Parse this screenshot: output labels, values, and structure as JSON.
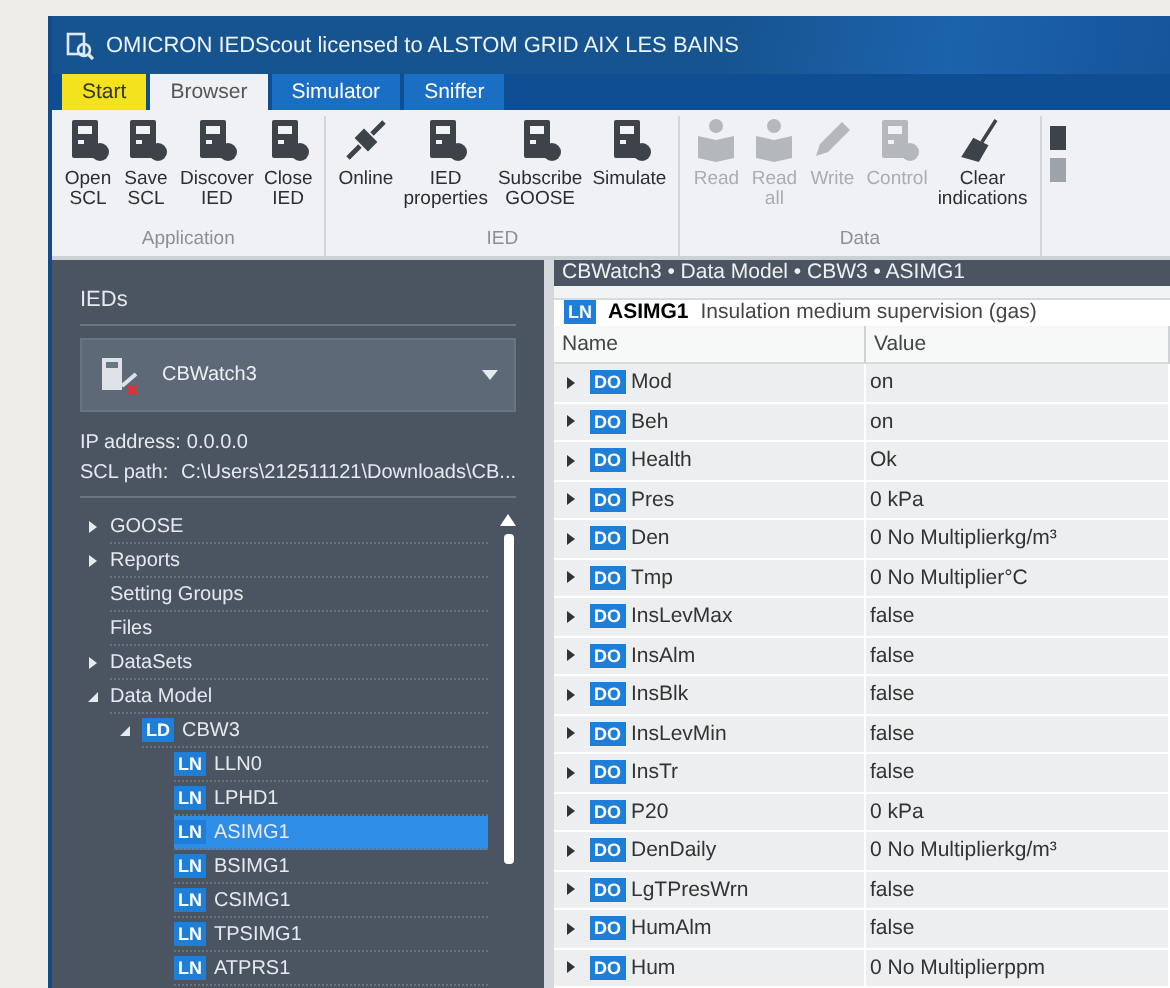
{
  "window": {
    "title": "OMICRON IEDScout licensed to ALSTOM GRID AIX LES BAINS"
  },
  "tabs": [
    {
      "label": "Start",
      "kind": "start",
      "selected": false
    },
    {
      "label": "Browser",
      "kind": "tab",
      "selected": true
    },
    {
      "label": "Simulator",
      "kind": "tab",
      "selected": false
    },
    {
      "label": "Sniffer",
      "kind": "tab",
      "selected": false
    }
  ],
  "ribbon_groups": [
    {
      "label": "Application",
      "buttons": [
        {
          "label": "Open\nSCL",
          "disabled": false
        },
        {
          "label": "Save\nSCL",
          "disabled": false
        },
        {
          "label": "Discover\nIED",
          "disabled": false
        },
        {
          "label": "Close\nIED",
          "disabled": false
        }
      ]
    },
    {
      "label": "IED",
      "buttons": [
        {
          "label": "Online",
          "disabled": false
        },
        {
          "label": "IED\nproperties",
          "disabled": false
        },
        {
          "label": "Subscribe\nGOOSE",
          "disabled": false
        },
        {
          "label": "Simulate",
          "disabled": false
        }
      ]
    },
    {
      "label": "Data",
      "buttons": [
        {
          "label": "Read",
          "disabled": true
        },
        {
          "label": "Read\nall",
          "disabled": true
        },
        {
          "label": "Write",
          "disabled": true
        },
        {
          "label": "Control",
          "disabled": true
        },
        {
          "label": "Clear\nindications",
          "disabled": false
        }
      ]
    }
  ],
  "sidebar": {
    "title": "IEDs",
    "device": {
      "name": "CBWatch3"
    },
    "ip_address": {
      "label": "IP address:",
      "value": "0.0.0.0"
    },
    "scl_path": {
      "label": "SCL path:",
      "value": "C:\\Users\\212511121\\Downloads\\CB..."
    },
    "tree": [
      {
        "label": "GOOSE",
        "expanded": false,
        "selected": false
      },
      {
        "label": "Reports",
        "expanded": false,
        "selected": false
      },
      {
        "label": "Setting Groups",
        "selected": false
      },
      {
        "label": "Files",
        "selected": false
      },
      {
        "label": "DataSets",
        "expanded": false,
        "selected": false
      },
      {
        "label": "Data Model",
        "expanded": true,
        "selected": false,
        "children": [
          {
            "label": "CBW3",
            "badge": "LD",
            "expanded": true,
            "selected": false,
            "children": [
              {
                "label": "LLN0",
                "badge": "LN",
                "selected": false
              },
              {
                "label": "LPHD1",
                "badge": "LN",
                "selected": false
              },
              {
                "label": "ASIMG1",
                "badge": "LN",
                "selected": true
              },
              {
                "label": "BSIMG1",
                "badge": "LN",
                "selected": false
              },
              {
                "label": "CSIMG1",
                "badge": "LN",
                "selected": false
              },
              {
                "label": "TPSIMG1",
                "badge": "LN",
                "selected": false
              },
              {
                "label": "ATPRS1",
                "badge": "LN",
                "selected": false
              }
            ]
          }
        ]
      }
    ]
  },
  "breadcrumb": "CBWatch3 • Data Model • CBW3 • ASIMG1",
  "node": {
    "badge": "LN",
    "name": "ASIMG1",
    "description": "Insulation medium supervision (gas)"
  },
  "table": {
    "columns": [
      "Name",
      "Value"
    ],
    "rows": [
      {
        "badge": "DO",
        "name": "Mod",
        "value": "on",
        "expanded": false
      },
      {
        "badge": "DO",
        "name": "Beh",
        "value": "on",
        "expanded": false
      },
      {
        "badge": "DO",
        "name": "Health",
        "value": "Ok",
        "expanded": false
      },
      {
        "badge": "DO",
        "name": "Pres",
        "value": "0 kPa",
        "expanded": false
      },
      {
        "badge": "DO",
        "name": "Den",
        "value": "0 No Multiplierkg/m³",
        "expanded": false
      },
      {
        "badge": "DO",
        "name": "Tmp",
        "value": "0 No Multiplier°C",
        "expanded": false
      },
      {
        "badge": "DO",
        "name": "InsLevMax",
        "value": "false",
        "expanded": false
      },
      {
        "badge": "DO",
        "name": "InsAlm",
        "value": "false",
        "expanded": false
      },
      {
        "badge": "DO",
        "name": "InsBlk",
        "value": "false",
        "expanded": false
      },
      {
        "badge": "DO",
        "name": "InsLevMin",
        "value": "false",
        "expanded": false
      },
      {
        "badge": "DO",
        "name": "InsTr",
        "value": "false",
        "expanded": false
      },
      {
        "badge": "DO",
        "name": "P20",
        "value": "0 kPa",
        "expanded": false
      },
      {
        "badge": "DO",
        "name": "DenDaily",
        "value": "0 No Multiplierkg/m³",
        "expanded": false
      },
      {
        "badge": "DO",
        "name": "LgTPresWrn",
        "value": "false",
        "expanded": false
      },
      {
        "badge": "DO",
        "name": "HumAlm",
        "value": "false",
        "expanded": false
      },
      {
        "badge": "DO",
        "name": "Hum",
        "value": "0 No Multiplierppm",
        "expanded": false
      }
    ]
  }
}
